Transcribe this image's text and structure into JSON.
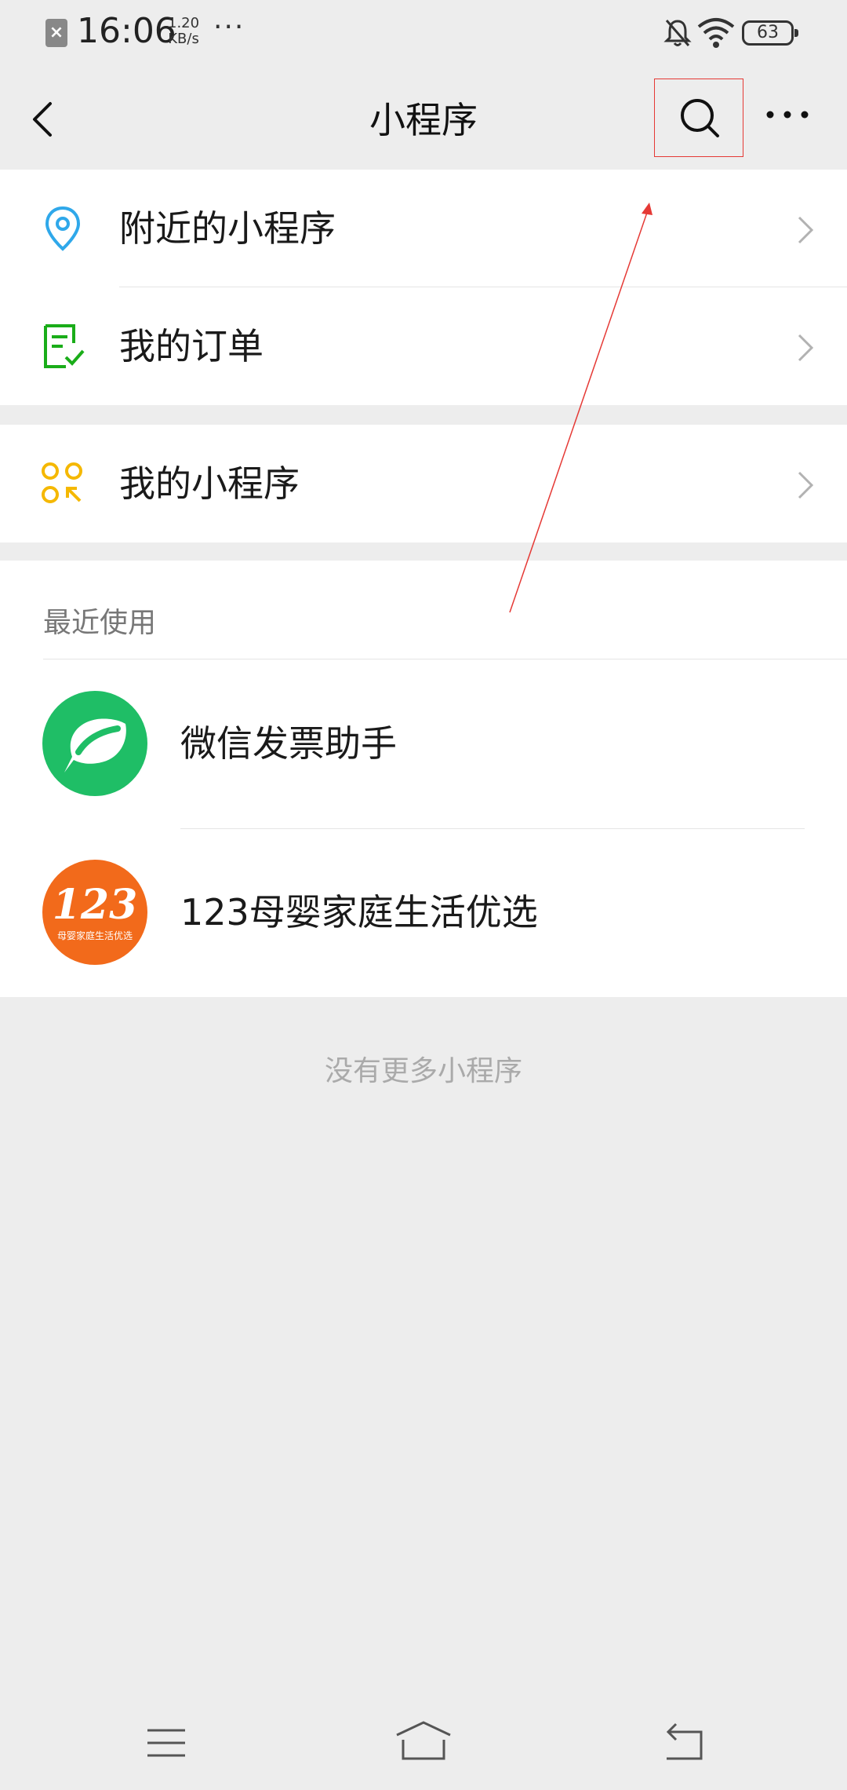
{
  "status_bar": {
    "time": "16:06",
    "speed_value": "1.20",
    "speed_unit": "KB/s",
    "dots": "···",
    "battery": "63"
  },
  "nav": {
    "title": "小程序",
    "icons": [
      "back-icon",
      "search-icon",
      "more-icon"
    ]
  },
  "menu": {
    "items": [
      {
        "label": "附近的小程序",
        "icon": "location-pin-icon",
        "color": "#2fa8ea"
      },
      {
        "label": "我的订单",
        "icon": "order-check-icon",
        "color": "#1aad19"
      },
      {
        "label": "我的小程序",
        "icon": "my-miniprogram-icon",
        "color": "#f5b800"
      }
    ]
  },
  "recent": {
    "section_label": "最近使用",
    "items": [
      {
        "name": "微信发票助手",
        "avatar_color": "#1fbe66"
      },
      {
        "name": "123母婴家庭生活优选",
        "avatar_color": "#f26a1b",
        "logo_text": "123",
        "logo_subtext": "母婴家庭生活优选"
      }
    ]
  },
  "empty_note": "没有更多小程序",
  "colors": {
    "background": "#ededed",
    "annotation": "#e53935"
  }
}
